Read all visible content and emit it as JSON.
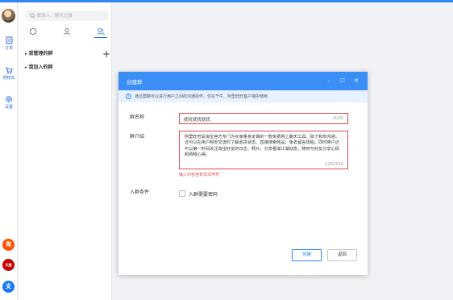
{
  "app": {
    "accent": "#2f86f6",
    "error_color": "#d94a4a"
  },
  "rail": {
    "items": [
      {
        "label": "订单",
        "icon": "order-icon"
      },
      {
        "label": "购物车",
        "icon": "cart-icon"
      },
      {
        "label": "设置",
        "icon": "gear-icon"
      }
    ],
    "bottom_apps": [
      {
        "glyph": "淘",
        "icon": "taobao-icon",
        "color": "#ff5000"
      },
      {
        "glyph": "天猫",
        "icon": "tmall-icon",
        "color": "#c40000"
      },
      {
        "glyph": "支",
        "icon": "alipay-icon",
        "color": "#1677ff"
      }
    ]
  },
  "panel": {
    "search_placeholder": "联系人、聊天记录",
    "tabs": [
      "recent-chats-icon",
      "contacts-icon",
      "groups-icon"
    ],
    "active_tab": 2,
    "groups": [
      {
        "label": "我管理的群"
      },
      {
        "label": "我加入的群"
      }
    ],
    "add_symbol": "+"
  },
  "dialog": {
    "title": "创建群",
    "controls": [
      "–",
      "□",
      "✕"
    ],
    "info": "通过群聊可以进行用户之间的沟通协作，仅在千牛、阿里旺旺客户端中使用",
    "name_label": "群名称",
    "name_value": "扰扰扰扰扰扰",
    "name_count": "6/20",
    "intro_label": "群介绍",
    "intro_value": "阿里旺旺是淘宝官方专门为买家量身定做的一款免费网上聊天工具。除了和你沟通，还可以在用户和你交流时了解收货状态、直接搜索商品、免去留言烦恼。同时用户还可以第一时间关注淘宝好友的日志、照片，分享看淘江湖动态，随时与好友分享心情和购物心得。",
    "intro_count": "120/200",
    "error_text": "输入内容含有非法字符",
    "join_label": "入群条件",
    "join_option": "入群需要密码",
    "join_checked": false,
    "create_label": "创建",
    "back_label": "返回"
  }
}
